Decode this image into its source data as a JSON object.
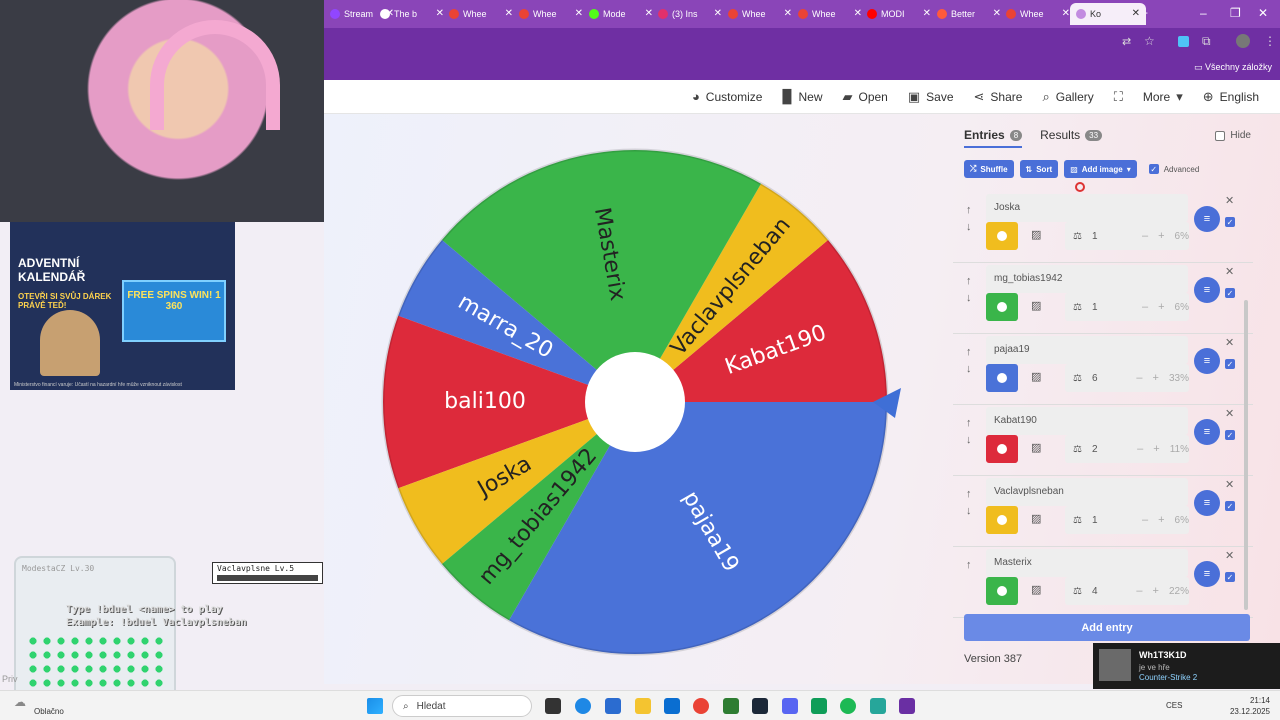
{
  "browser": {
    "tabs": [
      {
        "label": "Stream",
        "color": "#9146ff"
      },
      {
        "label": "The b",
        "color": "#ffffff"
      },
      {
        "label": "Whee",
        "color": "#ea4335"
      },
      {
        "label": "Whee",
        "color": "#ea4335"
      },
      {
        "label": "Mode",
        "color": "#53fc18"
      },
      {
        "label": "(3) Ins",
        "color": "#e1306c"
      },
      {
        "label": "Whee",
        "color": "#ea4335"
      },
      {
        "label": "Whee",
        "color": "#ea4335"
      },
      {
        "label": "MODI",
        "color": "#ff0000"
      },
      {
        "label": "Better",
        "color": "#ff5a3c"
      },
      {
        "label": "Whee",
        "color": "#ea4335"
      },
      {
        "label": "Ko",
        "color": "#c28be0"
      }
    ],
    "new_tab": "+",
    "bookmarks_label": "Všechny záložky"
  },
  "toolbar": {
    "customize": "Customize",
    "new": "New",
    "open": "Open",
    "save": "Save",
    "share": "Share",
    "gallery": "Gallery",
    "more": "More",
    "language": "English"
  },
  "wheel": {
    "segments": [
      {
        "label": "Kabat190",
        "color": "#dd2a3b",
        "weight": 2
      },
      {
        "label": "Vaclavplsneban",
        "color": "#f0bd1e",
        "weight": 1
      },
      {
        "label": "Masterix",
        "color": "#3ab54a",
        "weight": 4
      },
      {
        "label": "marra_20",
        "color": "#4a72d8",
        "weight": 1
      },
      {
        "label": "bali100",
        "color": "#dd2a3b",
        "weight": 2
      },
      {
        "label": "Joska",
        "color": "#f0bd1e",
        "weight": 1
      },
      {
        "label": "mg_tobias1942",
        "color": "#3ab54a",
        "weight": 1
      },
      {
        "label": "pajaa19",
        "color": "#4a72d8",
        "weight": 6
      }
    ]
  },
  "panel": {
    "entries_tab": "Entries",
    "entries_count": "8",
    "results_tab": "Results",
    "results_count": "33",
    "hide_label": "Hide",
    "shuffle": "Shuffle",
    "sort": "Sort",
    "add_image": "Add image",
    "advanced": "Advanced",
    "entries": [
      {
        "name": "Joska",
        "color": "#f0bd1e",
        "weight": "1",
        "percent": "6%"
      },
      {
        "name": "mg_tobias1942",
        "color": "#3ab54a",
        "weight": "1",
        "percent": "6%"
      },
      {
        "name": "pajaa19",
        "color": "#4a72d8",
        "weight": "6",
        "percent": "33%"
      },
      {
        "name": "Kabat190",
        "color": "#dd2a3b",
        "weight": "2",
        "percent": "11%"
      },
      {
        "name": "Vaclavplsneban",
        "color": "#f0bd1e",
        "weight": "1",
        "percent": "6%"
      },
      {
        "name": "Masterix",
        "color": "#3ab54a",
        "weight": "4",
        "percent": "22%"
      }
    ],
    "add_entry": "Add entry",
    "version": "Version 387"
  },
  "overlay": {
    "ad_title": "ADVENTNÍ KALENDÁŘ",
    "ad_sub": "OTEVŘI SI SVŮJ DÁREK PRÁVĚ TEĎ!",
    "ad_box": "FREE SPINS WIN! 1 360",
    "ad_footer": "Ministerstvo financí varuje: Účastí na hazardní hře může vzniknout závislost",
    "jar_label": "ModestaCZ  Lv.30",
    "player_name": "Vaclavplsne Lv.5",
    "player_hp": "HP:",
    "game_line1": "Type !bduel <name> to play",
    "game_line2": "Example: !bduel Vaclavplsneban",
    "privacy": "Priv"
  },
  "notification": {
    "user": "Wh1T3K1D",
    "status": "je ve hře",
    "game": "Counter-Strike 2"
  },
  "taskbar": {
    "weather": "Oblačno",
    "search_placeholder": "Hledat",
    "lang": "CES",
    "time": "21:14",
    "date": "23.12.2025"
  }
}
